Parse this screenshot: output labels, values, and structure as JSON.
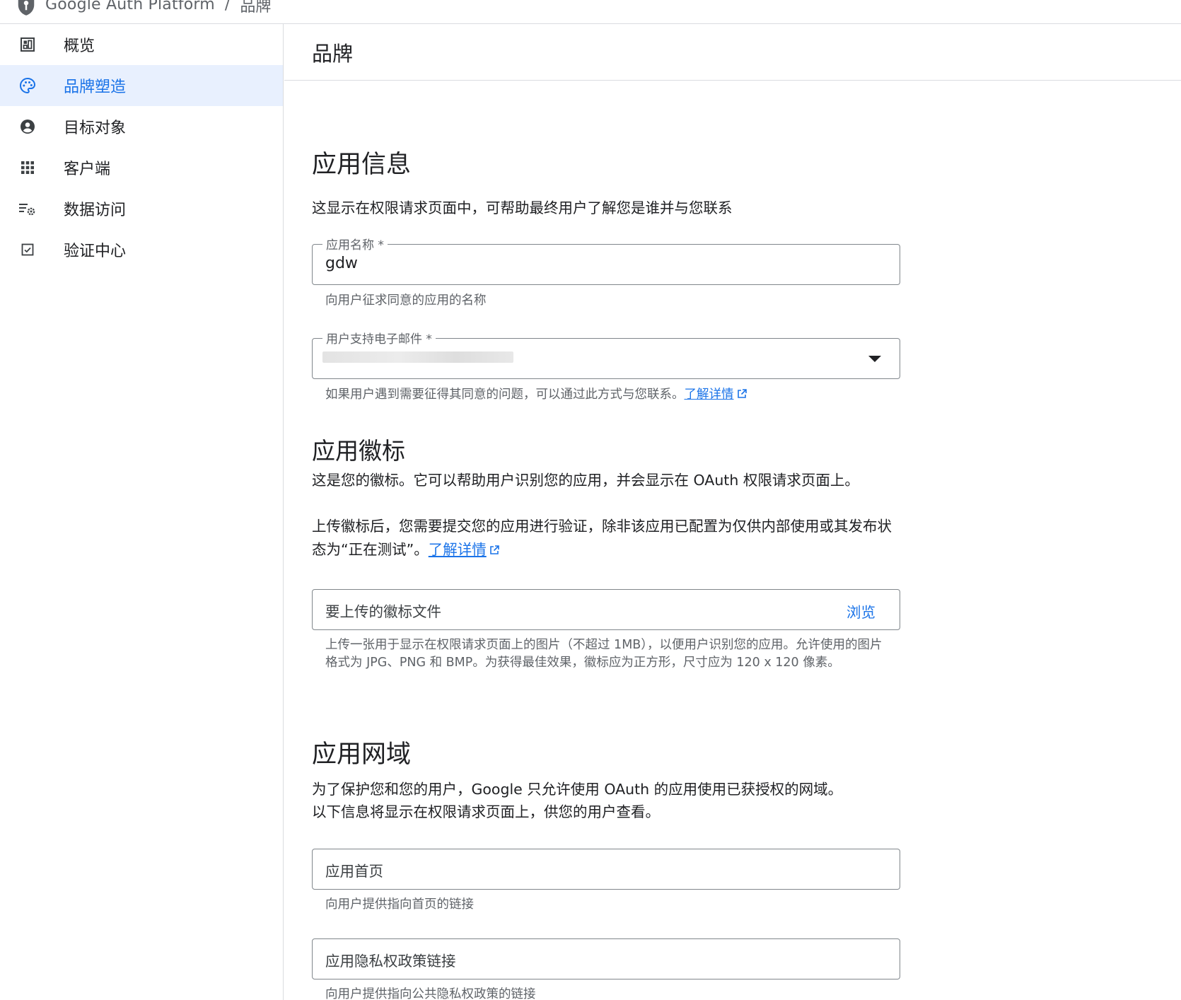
{
  "breadcrumb": {
    "product": "Google Auth Platform",
    "separator": "/",
    "current": "品牌"
  },
  "sidebar": {
    "items": [
      {
        "label": "概览",
        "icon": "dashboard-icon",
        "active": false
      },
      {
        "label": "品牌塑造",
        "icon": "palette-icon",
        "active": true
      },
      {
        "label": "目标对象",
        "icon": "account-circle-icon",
        "active": false
      },
      {
        "label": "客户端",
        "icon": "apps-grid-icon",
        "active": false
      },
      {
        "label": "数据访问",
        "icon": "data-settings-icon",
        "active": false
      },
      {
        "label": "验证中心",
        "icon": "checkbox-icon",
        "active": false
      }
    ]
  },
  "page": {
    "title": "品牌"
  },
  "app_info": {
    "heading": "应用信息",
    "description": "这显示在权限请求页面中，可帮助最终用户了解您是谁并与您联系",
    "app_name": {
      "label": "应用名称 *",
      "value": "gdw",
      "hint": "向用户征求同意的应用的名称"
    },
    "support_email": {
      "label": "用户支持电子邮件 *",
      "hint": "如果用户遇到需要征得其同意的问题，可以通过此方式与您联系。",
      "learn_more": "了解详情"
    }
  },
  "app_logo": {
    "heading": "应用徽标",
    "description_1": "这是您的徽标。它可以帮助用户识别您的应用，并会显示在 OAuth 权限请求页面上。",
    "description_2": "上传徽标后，您需要提交您的应用进行验证，除非该应用已配置为仅供内部使用或其发布状态为“正在测试”。",
    "learn_more": "了解详情",
    "upload": {
      "placeholder": "要上传的徽标文件",
      "browse_label": "浏览",
      "hint": "上传一张用于显示在权限请求页面上的图片（不超过 1MB），以便用户识别您的应用。允许使用的图片格式为 JPG、PNG 和 BMP。为获得最佳效果，徽标应为正方形，尺寸应为 120 x 120 像素。"
    }
  },
  "app_domain": {
    "heading": "应用网域",
    "description_1": "为了保护您和您的用户，Google 只允许使用 OAuth 的应用使用已获授权的网域。",
    "description_2": "以下信息将显示在权限请求页面上，供您的用户查看。",
    "homepage": {
      "placeholder": "应用首页",
      "hint": "向用户提供指向首页的链接"
    },
    "privacy": {
      "placeholder": "应用隐私权政策链接",
      "hint": "向用户提供指向公共隐私权政策的链接"
    }
  }
}
